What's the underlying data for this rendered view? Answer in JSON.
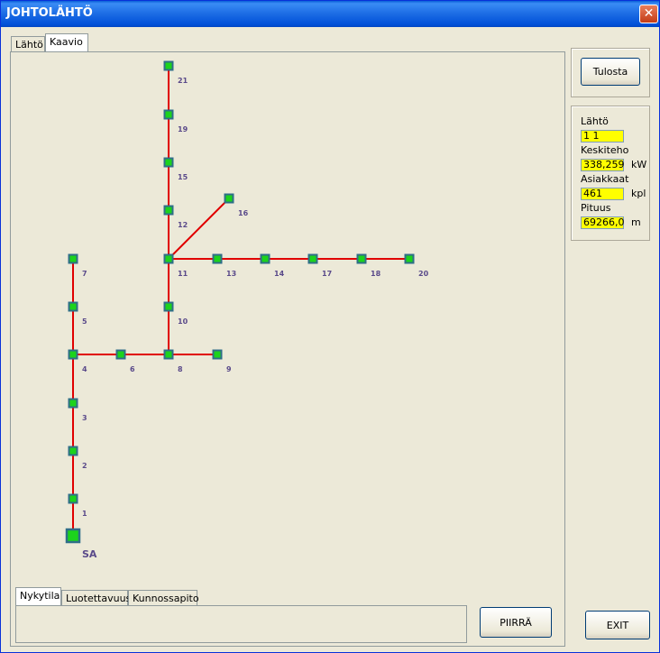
{
  "window": {
    "title": "JOHTOLÄHTÖ",
    "close_icon": "close-icon"
  },
  "top_tabs": [
    "Lähtö",
    "Kaavio"
  ],
  "bottom_tabs": [
    "Nykytila",
    "Luotettavuus",
    "Kunnossapito"
  ],
  "buttons": {
    "print": "Tulosta",
    "draw": "PIIRRÄ",
    "exit": "EXIT"
  },
  "info": {
    "lahto_label": "Lähtö",
    "lahto_value": "1  1",
    "keskiteho_label": "Keskiteho",
    "keskiteho_value": "338,259",
    "keskiteho_unit": "kW",
    "asiakkaat_label": "Asiakkaat",
    "asiakkaat_value": "461",
    "asiakkaat_unit": "kpl",
    "pituus_label": "Pituus",
    "pituus_value": "69266,0",
    "pituus_unit": "m"
  },
  "diagram": {
    "line_color": "#e00000",
    "node_fill": "#1cd31c",
    "node_border": "#2f6e88",
    "label_color": "#5a4a8a",
    "source_label": "SA",
    "nodes": [
      {
        "id": "21"
      },
      {
        "id": "19"
      },
      {
        "id": "15"
      },
      {
        "id": "16"
      },
      {
        "id": "12"
      },
      {
        "id": "7"
      },
      {
        "id": "11"
      },
      {
        "id": "13"
      },
      {
        "id": "14"
      },
      {
        "id": "17"
      },
      {
        "id": "18"
      },
      {
        "id": "20"
      },
      {
        "id": "5"
      },
      {
        "id": "10"
      },
      {
        "id": "4"
      },
      {
        "id": "6"
      },
      {
        "id": "8"
      },
      {
        "id": "9"
      },
      {
        "id": "3"
      },
      {
        "id": "2"
      },
      {
        "id": "1"
      }
    ],
    "edges": [
      [
        "SA",
        "1"
      ],
      [
        "1",
        "2"
      ],
      [
        "2",
        "3"
      ],
      [
        "3",
        "4"
      ],
      [
        "4",
        "5"
      ],
      [
        "5",
        "7"
      ],
      [
        "4",
        "6"
      ],
      [
        "6",
        "8"
      ],
      [
        "8",
        "9"
      ],
      [
        "8",
        "10"
      ],
      [
        "10",
        "11"
      ],
      [
        "11",
        "12"
      ],
      [
        "12",
        "15"
      ],
      [
        "15",
        "19"
      ],
      [
        "19",
        "21"
      ],
      [
        "11",
        "16"
      ],
      [
        "11",
        "13"
      ],
      [
        "13",
        "14"
      ],
      [
        "14",
        "17"
      ],
      [
        "17",
        "18"
      ],
      [
        "18",
        "20"
      ]
    ]
  }
}
